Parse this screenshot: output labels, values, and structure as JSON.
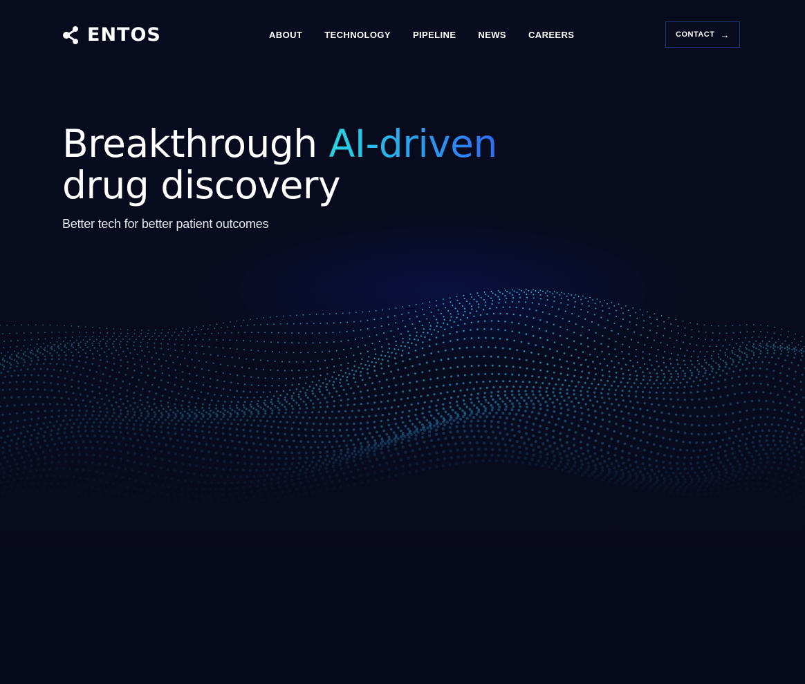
{
  "brand": {
    "name": "ENTOS",
    "logo_icon": "molecule-icon"
  },
  "nav": {
    "items": [
      {
        "label": "ABOUT"
      },
      {
        "label": "TECHNOLOGY"
      },
      {
        "label": "PIPELINE"
      },
      {
        "label": "NEWS"
      },
      {
        "label": "CAREERS"
      }
    ],
    "contact_label": "CONTACT",
    "contact_icon": "arrow-right-icon"
  },
  "hero": {
    "title_part1": "Breakthrough ",
    "title_accent": "AI-driven",
    "title_part2": "drug discovery",
    "subtitle": "Better tech for better patient outcomes"
  },
  "colors": {
    "background": "#080b1d",
    "accent_start": "#27d6e0",
    "accent_end": "#2f6cf3",
    "contact_border": "#1c3a7a",
    "wave_dots": "#3fc8f0"
  }
}
